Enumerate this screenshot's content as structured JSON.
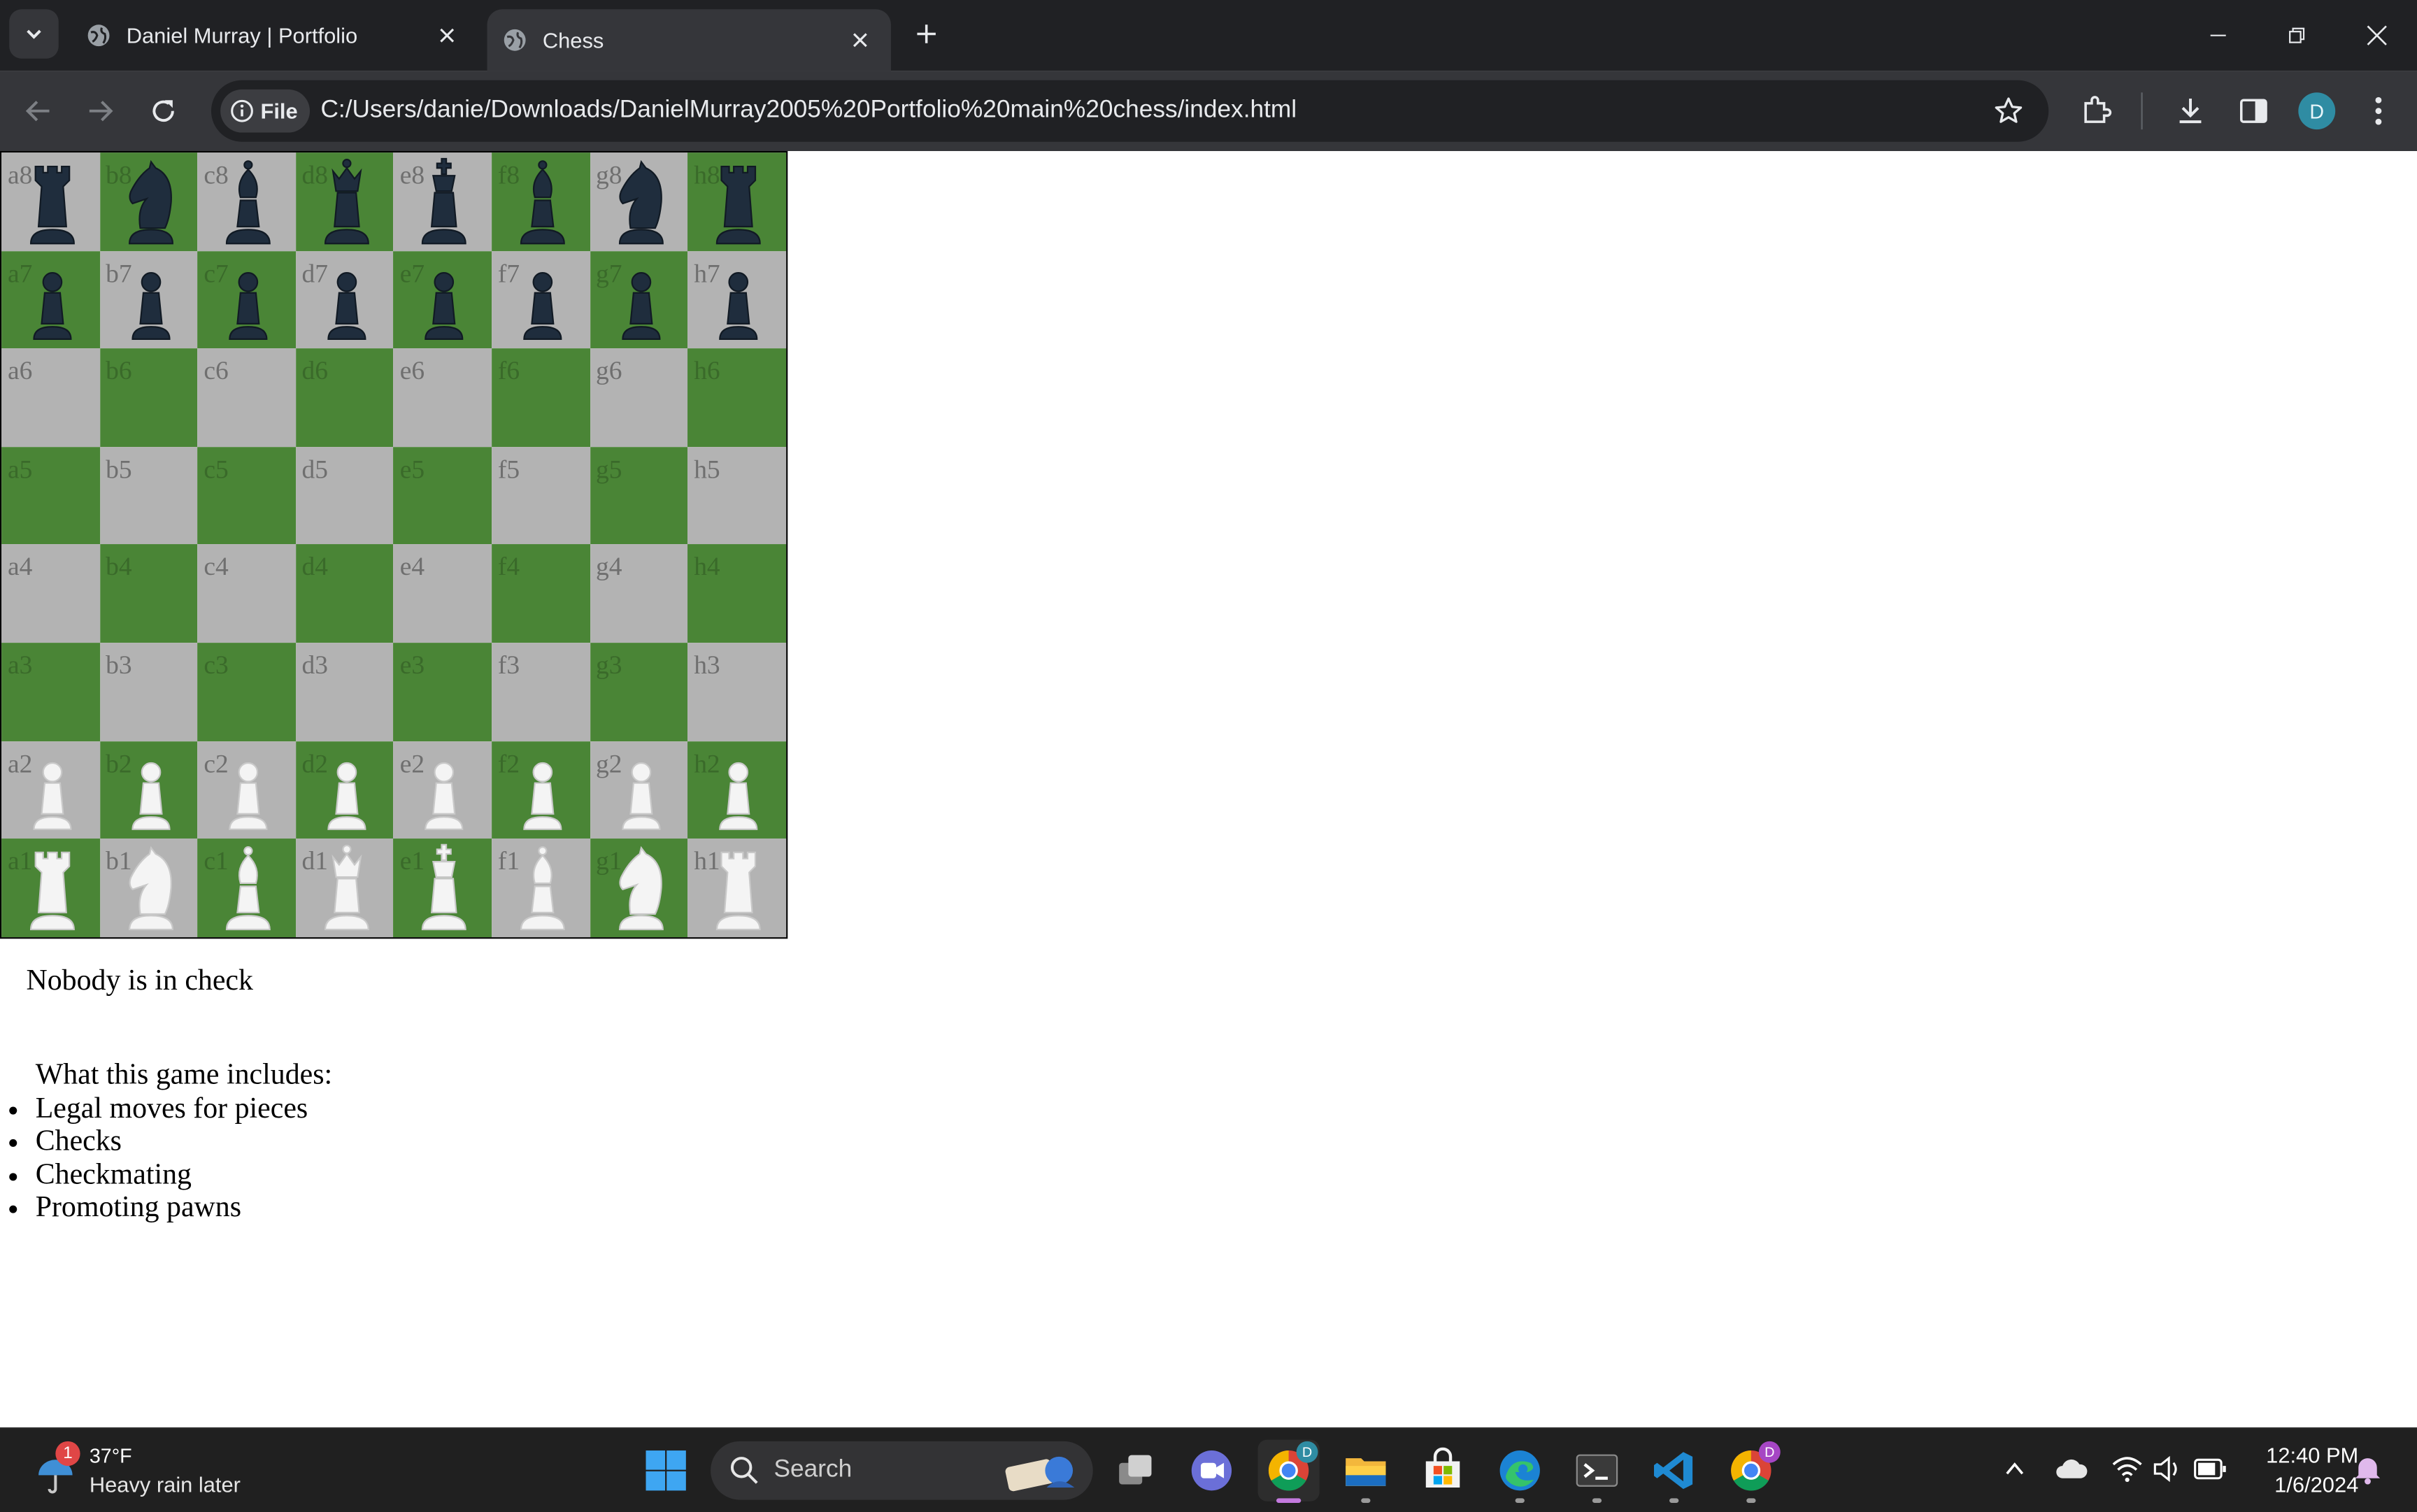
{
  "browser": {
    "tabs": [
      {
        "title": "Daniel Murray | Portfolio",
        "active": false
      },
      {
        "title": "Chess",
        "active": true
      }
    ],
    "site_chip": "File",
    "url": "C:/Users/danie/Downloads/DanielMurray2005%20Portfolio%20main%20chess/index.html",
    "profile_initial": "D"
  },
  "board": {
    "files": [
      "a",
      "b",
      "c",
      "d",
      "e",
      "f",
      "g",
      "h"
    ],
    "ranks": [
      "8",
      "7",
      "6",
      "5",
      "4",
      "3",
      "2",
      "1"
    ],
    "light_color": "#b3b3b3",
    "dark_color": "#4a8536",
    "position": [
      [
        "br",
        "bn",
        "bb",
        "bq",
        "bk",
        "bb",
        "bn",
        "br"
      ],
      [
        "bp",
        "bp",
        "bp",
        "bp",
        "bp",
        "bp",
        "bp",
        "bp"
      ],
      [
        "",
        "",
        "",
        "",
        "",
        "",
        "",
        ""
      ],
      [
        "",
        "",
        "",
        "",
        "",
        "",
        "",
        ""
      ],
      [
        "",
        "",
        "",
        "",
        "",
        "",
        "",
        ""
      ],
      [
        "",
        "",
        "",
        "",
        "",
        "",
        "",
        ""
      ],
      [
        "wp",
        "wp",
        "wp",
        "wp",
        "wp",
        "wp",
        "wp",
        "wp"
      ],
      [
        "wr",
        "wn",
        "wb",
        "wq",
        "wk",
        "wb",
        "wn",
        "wr"
      ]
    ]
  },
  "status": "Nobody is in check",
  "features": {
    "heading": "What this game includes:",
    "items": [
      "Legal moves for pieces",
      "Checks",
      "Checkmating",
      "Promoting pawns"
    ]
  },
  "taskbar": {
    "weather_temp": "37°F",
    "weather_desc": "Heavy rain later",
    "weather_badge": "1",
    "search_placeholder": "Search",
    "time": "12:40 PM",
    "date": "1/6/2024",
    "chrome_badge": "D"
  }
}
